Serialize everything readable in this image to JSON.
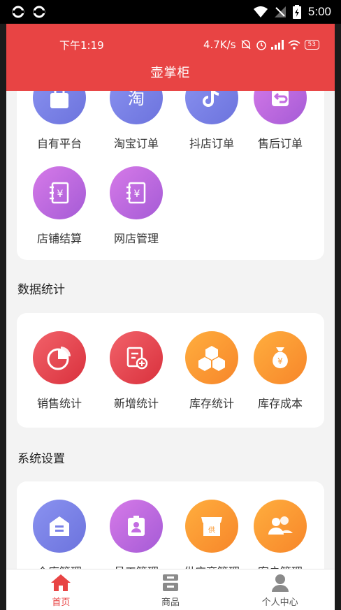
{
  "system_bar": {
    "time": "5:00"
  },
  "app_status": {
    "time": "下午1:19",
    "speed": "4.7K/s",
    "battery": "53"
  },
  "header": {
    "title": "壶掌柜"
  },
  "orders": {
    "items": [
      {
        "label": "自有平台",
        "icon": "bag-icon"
      },
      {
        "label": "淘宝订单",
        "icon": "taobao-icon"
      },
      {
        "label": "抖店订单",
        "icon": "douyin-icon"
      },
      {
        "label": "售后订单",
        "icon": "return-icon"
      },
      {
        "label": "店铺结算",
        "icon": "settlement-icon"
      },
      {
        "label": "网店管理",
        "icon": "settlement-icon"
      }
    ]
  },
  "stats": {
    "title": "数据统计",
    "items": [
      {
        "label": "销售统计",
        "icon": "pie-chart-icon"
      },
      {
        "label": "新增统计",
        "icon": "add-document-icon"
      },
      {
        "label": "库存统计",
        "icon": "boxes-icon"
      },
      {
        "label": "库存成本",
        "icon": "money-bag-icon"
      }
    ]
  },
  "settings": {
    "title": "系统设置",
    "items": [
      {
        "label": "仓库管理",
        "icon": "warehouse-icon"
      },
      {
        "label": "员工管理",
        "icon": "badge-icon"
      },
      {
        "label": "供应商管理",
        "icon": "store-icon"
      },
      {
        "label": "客户管理",
        "icon": "users-icon"
      }
    ]
  },
  "nav": {
    "items": [
      {
        "label": "首页",
        "icon": "home-icon"
      },
      {
        "label": "商品",
        "icon": "goods-icon"
      },
      {
        "label": "个人中心",
        "icon": "user-icon"
      }
    ]
  },
  "colors": {
    "brand": "#e84444",
    "blue": "#7a82e8",
    "violet": "#c36ce2",
    "red": "#e4474f",
    "orange": "#fb9a33"
  }
}
